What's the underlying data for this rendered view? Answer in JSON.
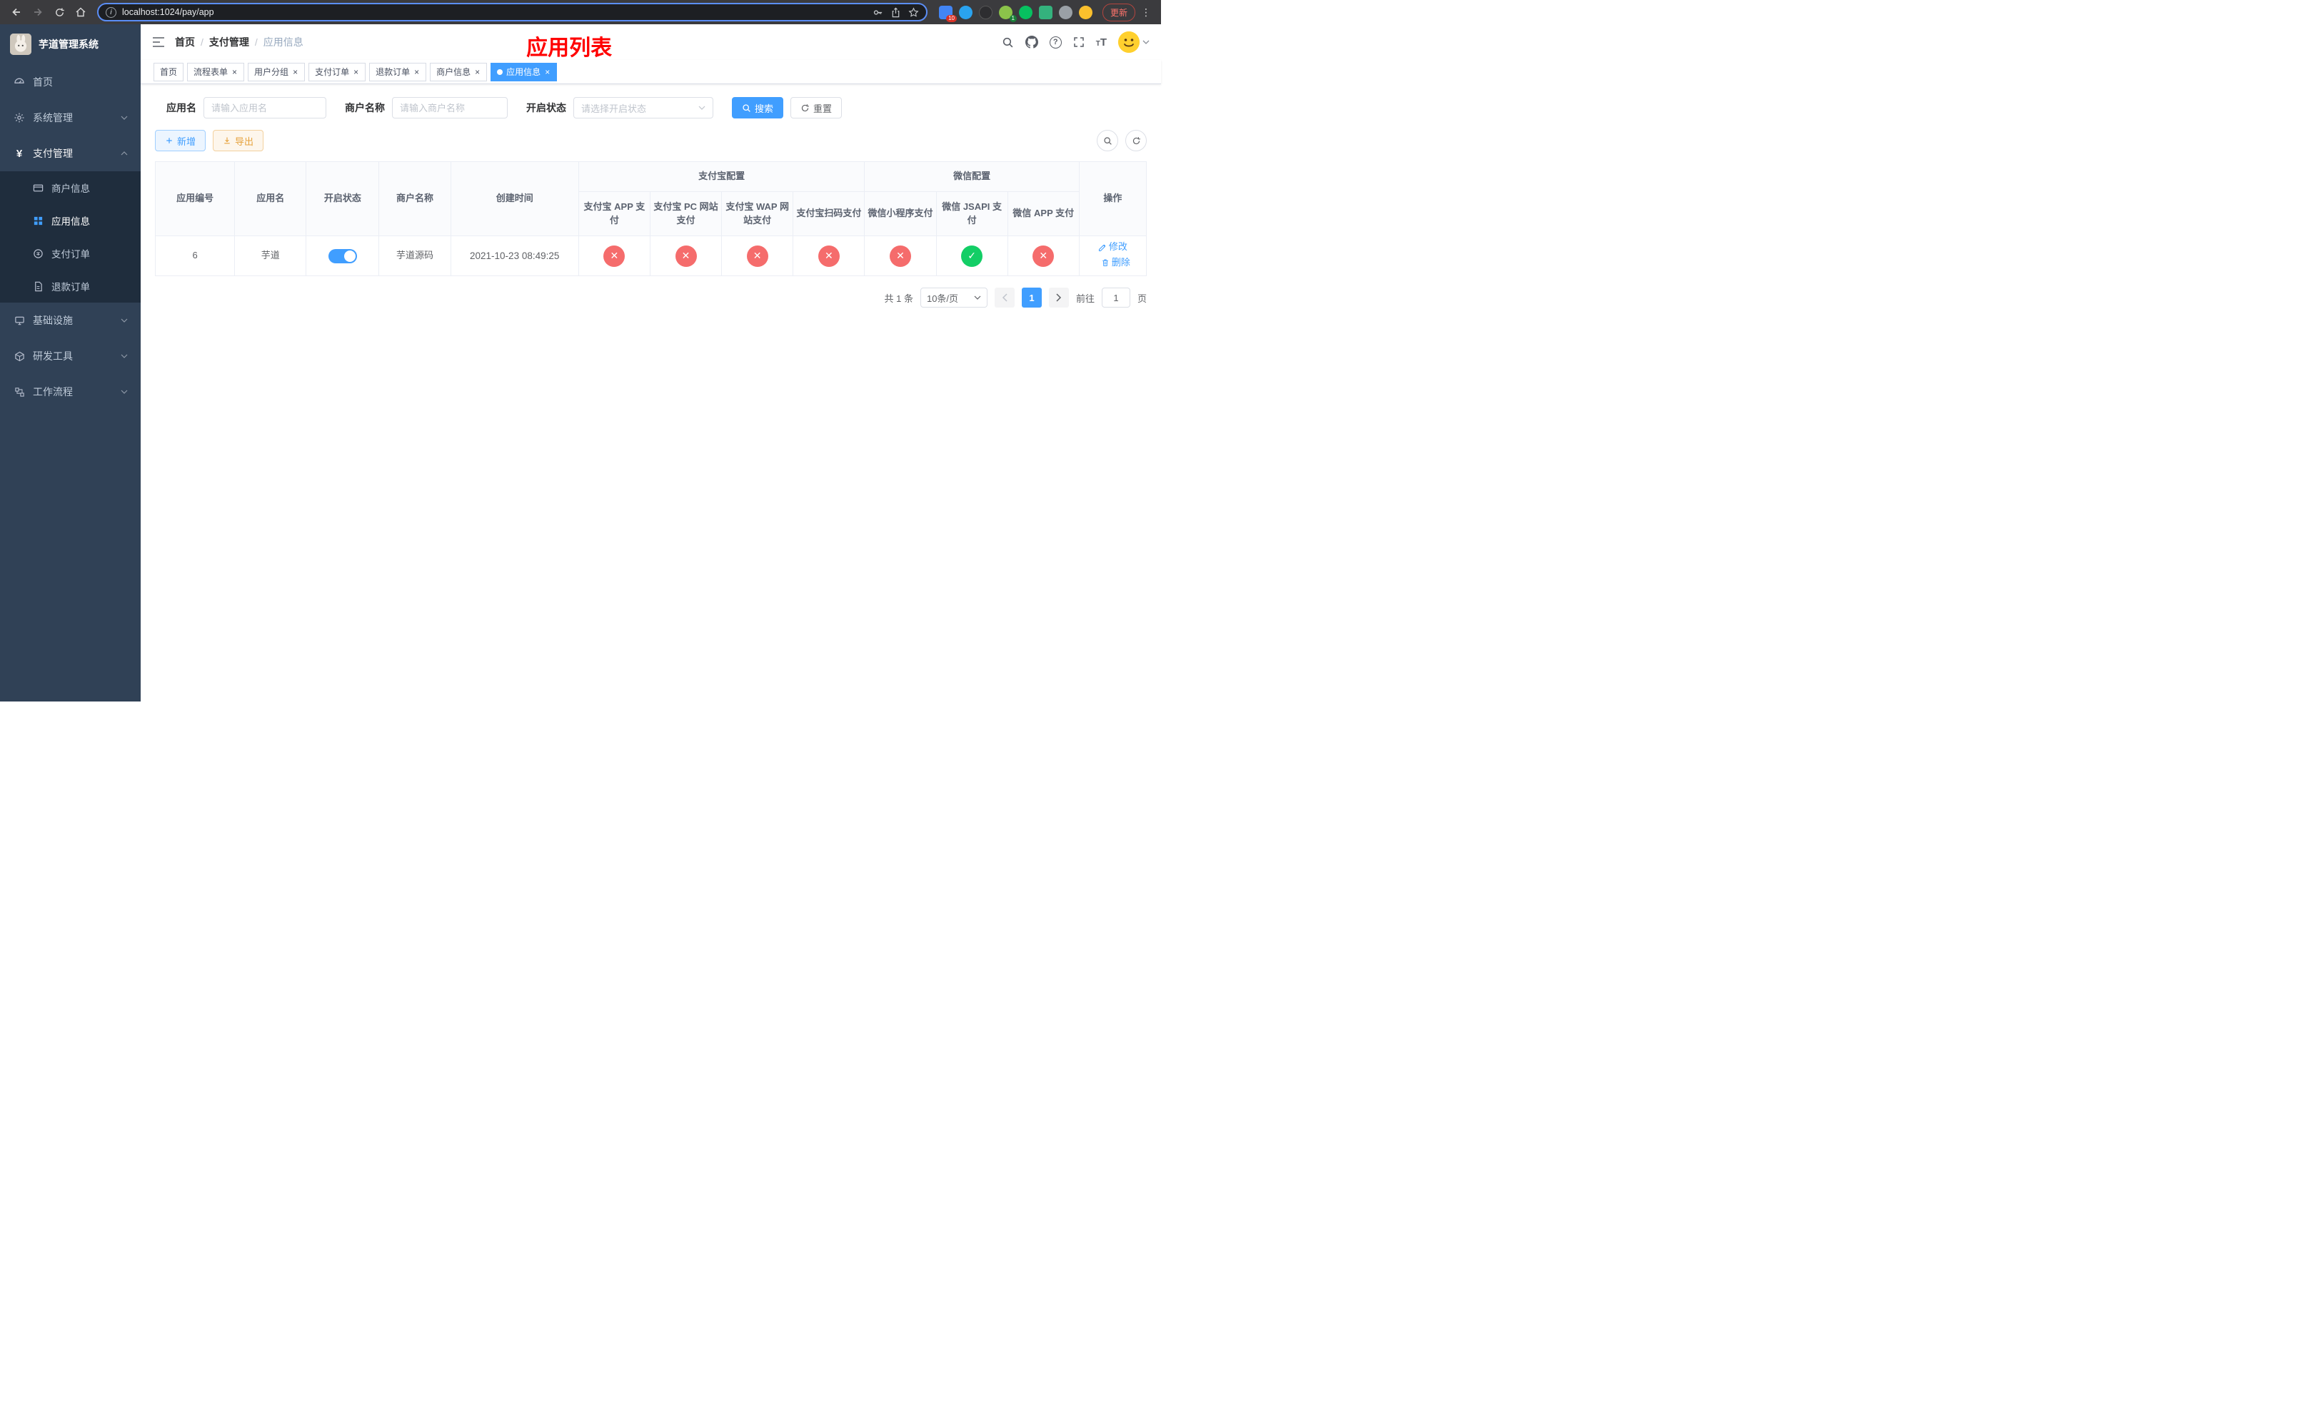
{
  "browser": {
    "url": "localhost:1024/pay/app",
    "update_label": "更新",
    "extensions": {
      "badge_count": "10",
      "avatar_badge": "1"
    }
  },
  "sidebar": {
    "title": "芋道管理系统",
    "items": [
      {
        "label": "首页"
      },
      {
        "label": "系统管理"
      },
      {
        "label": "支付管理",
        "expanded": true,
        "children": [
          {
            "label": "商户信息",
            "active": false
          },
          {
            "label": "应用信息",
            "active": true
          },
          {
            "label": "支付订单",
            "active": false
          },
          {
            "label": "退款订单",
            "active": false
          }
        ]
      },
      {
        "label": "基础设施"
      },
      {
        "label": "研发工具"
      },
      {
        "label": "工作流程"
      }
    ]
  },
  "navbar": {
    "breadcrumb": [
      "首页",
      "支付管理",
      "应用信息"
    ],
    "annotation": "应用列表"
  },
  "tabs": [
    {
      "label": "首页",
      "closable": false,
      "active": false
    },
    {
      "label": "流程表单",
      "closable": true,
      "active": false
    },
    {
      "label": "用户分组",
      "closable": true,
      "active": false
    },
    {
      "label": "支付订单",
      "closable": true,
      "active": false
    },
    {
      "label": "退款订单",
      "closable": true,
      "active": false
    },
    {
      "label": "商户信息",
      "closable": true,
      "active": false
    },
    {
      "label": "应用信息",
      "closable": true,
      "active": true
    }
  ],
  "filters": {
    "app_name": {
      "label": "应用名",
      "placeholder": "请输入应用名",
      "value": ""
    },
    "merchant_name": {
      "label": "商户名称",
      "placeholder": "请输入商户名称",
      "value": ""
    },
    "status": {
      "label": "开启状态",
      "placeholder": "请选择开启状态",
      "value": ""
    },
    "search_label": "搜索",
    "reset_label": "重置"
  },
  "toolbar": {
    "add_label": "新增",
    "export_label": "导出"
  },
  "table": {
    "columns": {
      "app_id": "应用编号",
      "app_name": "应用名",
      "status": "开启状态",
      "merchant": "商户名称",
      "created": "创建时间",
      "actions": "操作"
    },
    "groups": {
      "alipay": {
        "label": "支付宝配置",
        "columns": [
          "支付宝 APP 支付",
          "支付宝 PC 网站支付",
          "支付宝 WAP 网站支付",
          "支付宝扫码支付"
        ]
      },
      "wechat": {
        "label": "微信配置",
        "columns": [
          "微信小程序支付",
          "微信 JSAPI 支付",
          "微信 APP 支付"
        ]
      }
    },
    "rows": [
      {
        "app_id": "6",
        "app_name": "芋道",
        "enabled": true,
        "merchant": "芋道源码",
        "created": "2021-10-23 08:49:25",
        "statuses": [
          false,
          false,
          false,
          false,
          false,
          true,
          false
        ],
        "edit_label": "修改",
        "delete_label": "删除"
      }
    ]
  },
  "pagination": {
    "total": "共 1 条",
    "page_size": "10条/页",
    "current_page": "1",
    "goto_label": "前往",
    "goto_value": "1",
    "goto_unit": "页"
  },
  "colors": {
    "primary": "#409eff",
    "success": "#13ce66",
    "danger": "#f56c6c",
    "warning": "#e6a23c",
    "annotation": "#ff0000",
    "sidebar_bg": "#304156",
    "submenu_bg": "#1f2d3d"
  }
}
